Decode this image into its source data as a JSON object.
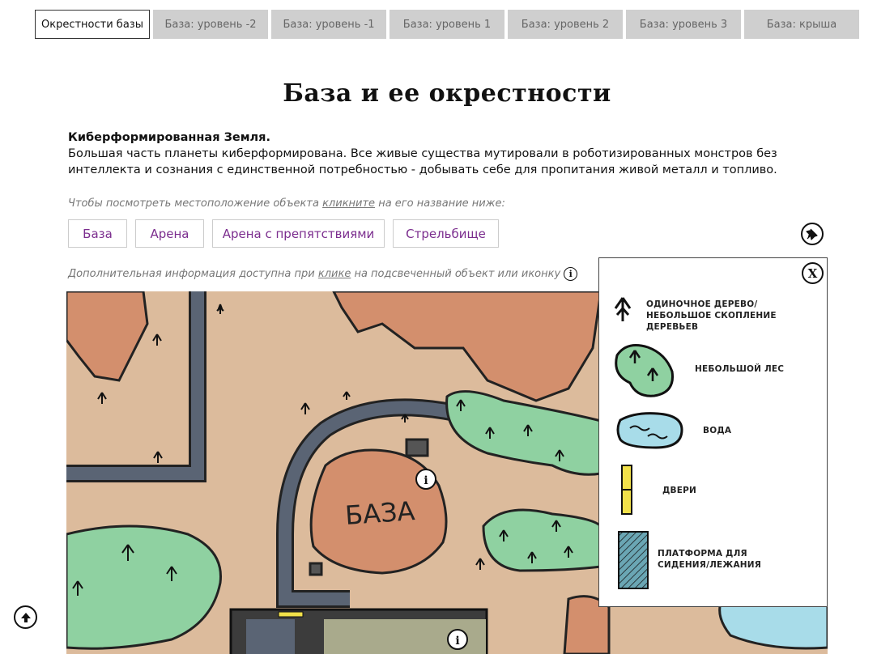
{
  "tabs": [
    {
      "label": "Окрестности базы",
      "active": true
    },
    {
      "label": "База: уровень -2",
      "active": false
    },
    {
      "label": "База: уровень -1",
      "active": false
    },
    {
      "label": "База: уровень 1",
      "active": false
    },
    {
      "label": "База: уровень 2",
      "active": false
    },
    {
      "label": "База: уровень 3",
      "active": false
    },
    {
      "label": "База: крыша",
      "active": false
    }
  ],
  "page_title": "База и ее окрестности",
  "description": {
    "heading": "Киберформированная Земля.",
    "text": "Большая часть планеты киберформирована. Все живые существа мутировали в роботизированных монстров без интеллекта и сознания с единственной потребностью - добывать себе для пропитания живой металл и топливо."
  },
  "location_hint": {
    "before": "Чтобы посмотреть местоположение объекта ",
    "link": "кликните",
    "after": " на его название ниже:"
  },
  "locations": [
    "База",
    "Арена",
    "Арена с препятствиями",
    "Стрельбище"
  ],
  "info_hint": {
    "before": "Дополнительная информация доступна при ",
    "link": "клике",
    "after": " на подсвеченный объект или иконку"
  },
  "map": {
    "base_label": "БАЗА"
  },
  "legend": {
    "items": [
      {
        "icon": "tree-icon",
        "label": "Одиночное дерево/небольшое скопление деревьев"
      },
      {
        "icon": "forest-icon",
        "label": "Небольшой лес"
      },
      {
        "icon": "water-icon",
        "label": "Вода"
      },
      {
        "icon": "door-icon",
        "label": "Двери"
      },
      {
        "icon": "platform-icon",
        "label": "Платформа для сидения/лежания"
      }
    ],
    "close_label": "X"
  },
  "colors": {
    "accent": "#7b2d8e",
    "ground": "#d9b99b",
    "forest": "#8fd1a1",
    "water": "#a8dce9",
    "road": "#5a6474",
    "rock": "#d3906f"
  }
}
